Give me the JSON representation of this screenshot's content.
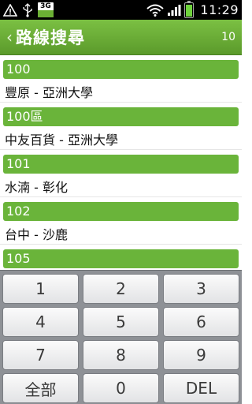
{
  "status_bar": {
    "icons": [
      "warning-icon",
      "usb-icon",
      "3g-icon",
      "wifi-icon",
      "signal-icon",
      "battery-icon"
    ],
    "network_label": "3G",
    "time": "11:29",
    "accent": "#6fd23c"
  },
  "header": {
    "back_glyph": "‹",
    "title": "路線搜尋",
    "count": "10",
    "color": "#6ab43a"
  },
  "routes": [
    {
      "number": "100",
      "description": "豐原 - 亞洲大學"
    },
    {
      "number": "100區",
      "description": "中友百貨 - 亞洲大學"
    },
    {
      "number": "101",
      "description": "水湳 - 彰化"
    },
    {
      "number": "102",
      "description": "台中 - 沙鹿"
    },
    {
      "number": "105",
      "description": ""
    }
  ],
  "keypad": {
    "keys": [
      "1",
      "2",
      "3",
      "4",
      "5",
      "6",
      "7",
      "8",
      "9",
      "全部",
      "0",
      "DEL"
    ]
  }
}
